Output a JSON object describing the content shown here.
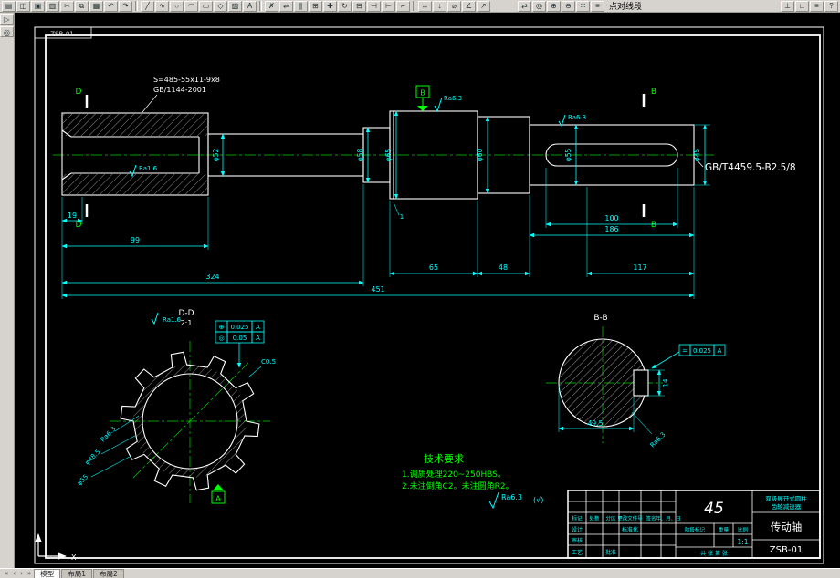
{
  "colors": {
    "canvas": "#000000",
    "line": "#ffffff",
    "dim": "#00ffff",
    "aux": "#00ff00",
    "chrome": "#d6d3ce"
  },
  "toolbar": {
    "items": [
      {
        "t": "i",
        "n": "new-file-icon",
        "g": "▤"
      },
      {
        "t": "i",
        "n": "open-file-icon",
        "g": "◫"
      },
      {
        "t": "i",
        "n": "save-icon",
        "g": "▣"
      },
      {
        "t": "i",
        "n": "print-icon",
        "g": "▥"
      },
      {
        "t": "i",
        "n": "cut-icon",
        "g": "✂"
      },
      {
        "t": "i",
        "n": "copy-icon",
        "g": "⧉"
      },
      {
        "t": "i",
        "n": "paste-icon",
        "g": "▦"
      },
      {
        "t": "i",
        "n": "undo-icon",
        "g": "↶"
      },
      {
        "t": "i",
        "n": "redo-icon",
        "g": "↷"
      },
      {
        "t": "s"
      },
      {
        "t": "i",
        "n": "draw-line-icon",
        "g": "╱"
      },
      {
        "t": "i",
        "n": "draw-polyline-icon",
        "g": "∿"
      },
      {
        "t": "i",
        "n": "draw-circle-icon",
        "g": "○"
      },
      {
        "t": "i",
        "n": "draw-arc-icon",
        "g": "◠"
      },
      {
        "t": "i",
        "n": "draw-rectangle-icon",
        "g": "▭"
      },
      {
        "t": "i",
        "n": "draw-polygon-icon",
        "g": "◇"
      },
      {
        "t": "i",
        "n": "hatch-icon",
        "g": "▨"
      },
      {
        "t": "i",
        "n": "text-icon",
        "g": "A"
      },
      {
        "t": "s"
      },
      {
        "t": "i",
        "n": "erase-icon",
        "g": "✗"
      },
      {
        "t": "i",
        "n": "mirror-icon",
        "g": "⇌"
      },
      {
        "t": "i",
        "n": "offset-icon",
        "g": "∥"
      },
      {
        "t": "i",
        "n": "array-icon",
        "g": "⊞"
      },
      {
        "t": "i",
        "n": "move-icon",
        "g": "✚"
      },
      {
        "t": "i",
        "n": "rotate-icon",
        "g": "↻"
      },
      {
        "t": "i",
        "n": "scale-icon",
        "g": "⊟"
      },
      {
        "t": "i",
        "n": "trim-icon",
        "g": "⊣"
      },
      {
        "t": "i",
        "n": "extend-icon",
        "g": "⊢"
      },
      {
        "t": "i",
        "n": "fillet-icon",
        "g": "⌐"
      },
      {
        "t": "s"
      },
      {
        "t": "i",
        "n": "dim-linear-icon",
        "g": "↔"
      },
      {
        "t": "i",
        "n": "dim-vertical-icon",
        "g": "↕"
      },
      {
        "t": "i",
        "n": "dim-radius-icon",
        "g": "⌀"
      },
      {
        "t": "i",
        "n": "dim-angle-icon",
        "g": "∠"
      },
      {
        "t": "i",
        "n": "leader-icon",
        "g": "↗"
      },
      {
        "t": "gap"
      },
      {
        "t": "i",
        "n": "pan-icon",
        "g": "⇄"
      },
      {
        "t": "i",
        "n": "zoom-window-icon",
        "g": "◎"
      },
      {
        "t": "i",
        "n": "zoom-in-icon",
        "g": "⊕"
      },
      {
        "t": "i",
        "n": "zoom-out-icon",
        "g": "⊖"
      },
      {
        "t": "i",
        "n": "distance-icon",
        "g": "∷"
      },
      {
        "t": "i",
        "n": "list-icon",
        "g": "≡"
      },
      {
        "t": "l",
        "n": "toolbar-hint-label",
        "text": "点对线段"
      },
      {
        "t": "sp"
      },
      {
        "t": "i",
        "n": "osnap-icon",
        "g": "⊥"
      },
      {
        "t": "i",
        "n": "ortho-icon",
        "g": "∟"
      },
      {
        "t": "i",
        "n": "layers-icon",
        "g": "≡"
      },
      {
        "t": "i",
        "n": "help-icon",
        "g": "?"
      }
    ]
  },
  "side_toolbar": {
    "items": [
      {
        "name": "pointer-icon",
        "glyph": "▷"
      },
      {
        "name": "zoom-tool-icon",
        "glyph": "◎"
      }
    ]
  },
  "status_tabs": {
    "nav": [
      "«",
      "‹",
      "›",
      "»"
    ],
    "model": "模型",
    "layout1": "布局1",
    "layout2": "布局2"
  },
  "drawing": {
    "corner_label": "ZSB-01",
    "ucs_x": "X",
    "spline_note": {
      "line1": "S=485-55x11-9x8",
      "line2": "GB/1144-2001"
    },
    "center_hole_note": "GB/T4459.5-B2.5/8",
    "datum": {
      "a": "A",
      "b": "B",
      "d": "D"
    },
    "sections": {
      "dd": "D-D",
      "dd_scale": "2:1",
      "bb": "B-B"
    },
    "dims": {
      "len19": "19",
      "len99": "99",
      "len324": "324",
      "len451": "451",
      "len65": "65",
      "len48": "48",
      "len117": "117",
      "len186": "186",
      "len100": "100",
      "groove": "1",
      "dia1": "φ52",
      "dia2": "φ58",
      "dia3": "φ65",
      "dia4": "φ60",
      "dia5": "φ55",
      "dia6": "φ45"
    },
    "roughness": {
      "r1": "Ra6.3",
      "r2": "Ra1.6",
      "r3": "Ra6.3",
      "global": "Ra6.3",
      "global_suffix": "(√)"
    },
    "dd_annot": {
      "tol1_sym": "⊕",
      "tol1_val": "0.025",
      "tol1_ref": "A",
      "tol2_sym": "◎",
      "tol2_val": "0.05",
      "tol2_ref": "A",
      "chamfer": "C0.5",
      "ra": "Ra1.6",
      "diag1": "Ra6.3",
      "diag2": "φ48.5",
      "diag3": "φ55"
    },
    "bb_annot": {
      "tol_sym": "=",
      "tol_val": "0.025",
      "tol_ref": "A",
      "width": "14",
      "depth": "49.5",
      "ra": "Ra6.3"
    },
    "tech_req": {
      "title": "技术要求",
      "line1": "1.调质处理220~250HBS。",
      "line2": "2.未注倒角C2。未注圆角R2。"
    },
    "title_block": {
      "material": "45",
      "part_name": "传动轴",
      "drawing_no": "ZSB-01",
      "scale_value": "1:1",
      "unit_line1": "双级展开式圆柱",
      "unit_line2": "齿轮减速器",
      "col_mark": "标记",
      "col_count": "处数",
      "col_zone": "分区",
      "col_doc": "更改文件号",
      "col_sign": "签名",
      "col_date": "年、月、日",
      "row_design": "设计",
      "row_std": "标准化",
      "row_check": "审核",
      "row_process": "工艺",
      "row_approve": "批准",
      "stage": "阶段标记",
      "weight": "重量",
      "scale_label": "比例",
      "sheets": "共 张 第 张"
    }
  }
}
